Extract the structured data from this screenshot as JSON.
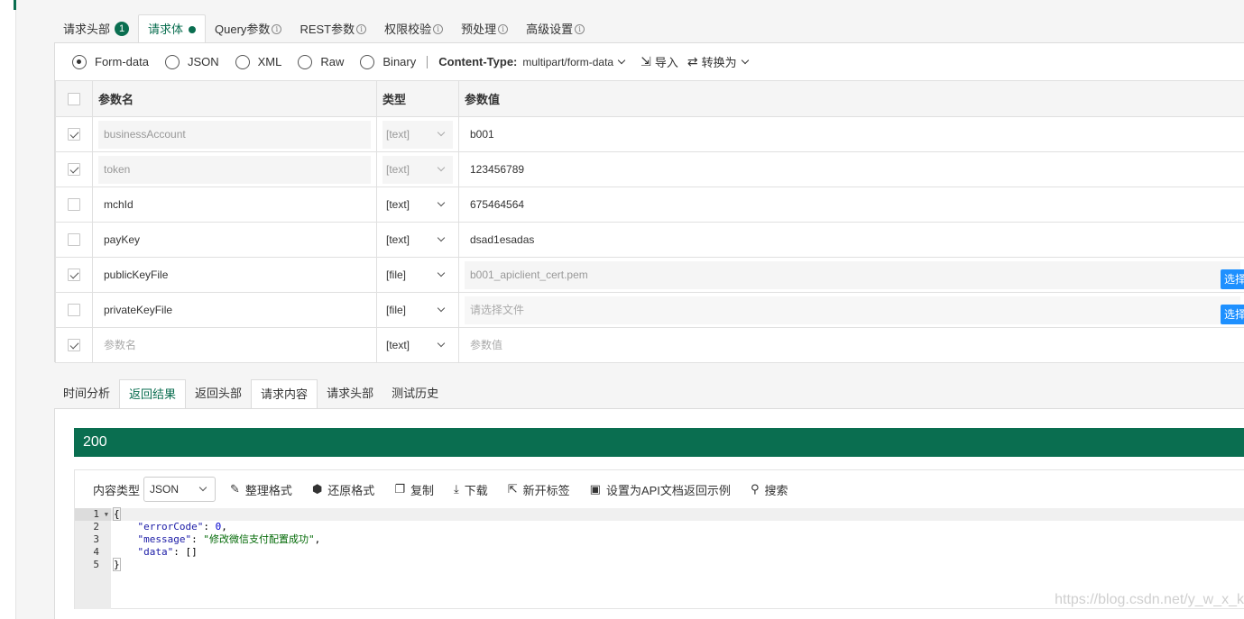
{
  "request_tabs": [
    {
      "label": "请求头部",
      "badge": "1"
    },
    {
      "label": "请求体",
      "dot": true
    },
    {
      "label": "Query参数",
      "info": "i"
    },
    {
      "label": "REST参数",
      "info": "i"
    },
    {
      "label": "权限校验",
      "info": "i"
    },
    {
      "label": "预处理",
      "info": "i"
    },
    {
      "label": "高级设置",
      "info": "i"
    }
  ],
  "body_types": [
    "Form-data",
    "JSON",
    "XML",
    "Raw",
    "Binary"
  ],
  "selected_body_type": "Form-data",
  "content_type": {
    "label": "Content-Type:",
    "value": "multipart/form-data"
  },
  "toolbar_actions": {
    "import": "导入",
    "convert": "转换为"
  },
  "params_table": {
    "headers": {
      "name": "参数名",
      "type": "类型",
      "value": "参数值"
    },
    "rows": [
      {
        "checked": true,
        "name": "businessAccount",
        "type": "[text]",
        "value": "b001",
        "locked": true
      },
      {
        "checked": true,
        "name": "token",
        "type": "[text]",
        "value": "123456789",
        "locked": true
      },
      {
        "checked": false,
        "name": "mchId",
        "type": "[text]",
        "value": "675464564"
      },
      {
        "checked": false,
        "name": "payKey",
        "type": "[text]",
        "value": "dsad1esadas"
      },
      {
        "checked": true,
        "name": "publicKeyFile",
        "type": "[file]",
        "value": "b001_apiclient_cert.pem",
        "file": true
      },
      {
        "checked": false,
        "name": "privateKeyFile",
        "type": "[file]",
        "value": "请选择文件",
        "file": true,
        "value_placeholder": true
      },
      {
        "checked": true,
        "name": "参数名",
        "type": "[text]",
        "value": "参数值",
        "placeholder": true
      }
    ],
    "choose_button": "选择"
  },
  "response_tabs": [
    "时间分析",
    "返回结果",
    "返回头部",
    "请求内容",
    "请求头部",
    "测试历史"
  ],
  "status_code": "200",
  "response_toolbar": {
    "content_type_label": "内容类型",
    "content_type_value": "JSON",
    "actions": [
      "整理格式",
      "还原格式",
      "复制",
      "下载",
      "新开标签",
      "设置为API文档返回示例",
      "搜索"
    ]
  },
  "code_lines": [
    {
      "n": "1",
      "text": "{"
    },
    {
      "n": "2",
      "key": "\"errorCode\"",
      "val": "0",
      "val_kind": "num"
    },
    {
      "n": "3",
      "key": "\"message\"",
      "val": "\"修改微信支付配置成功\"",
      "val_kind": "str"
    },
    {
      "n": "4",
      "key": "\"data\"",
      "val": "[]",
      "val_kind": "plain"
    },
    {
      "n": "5",
      "text": "}"
    }
  ],
  "watermark": "https://blog.csdn.net/y_w_x_k"
}
